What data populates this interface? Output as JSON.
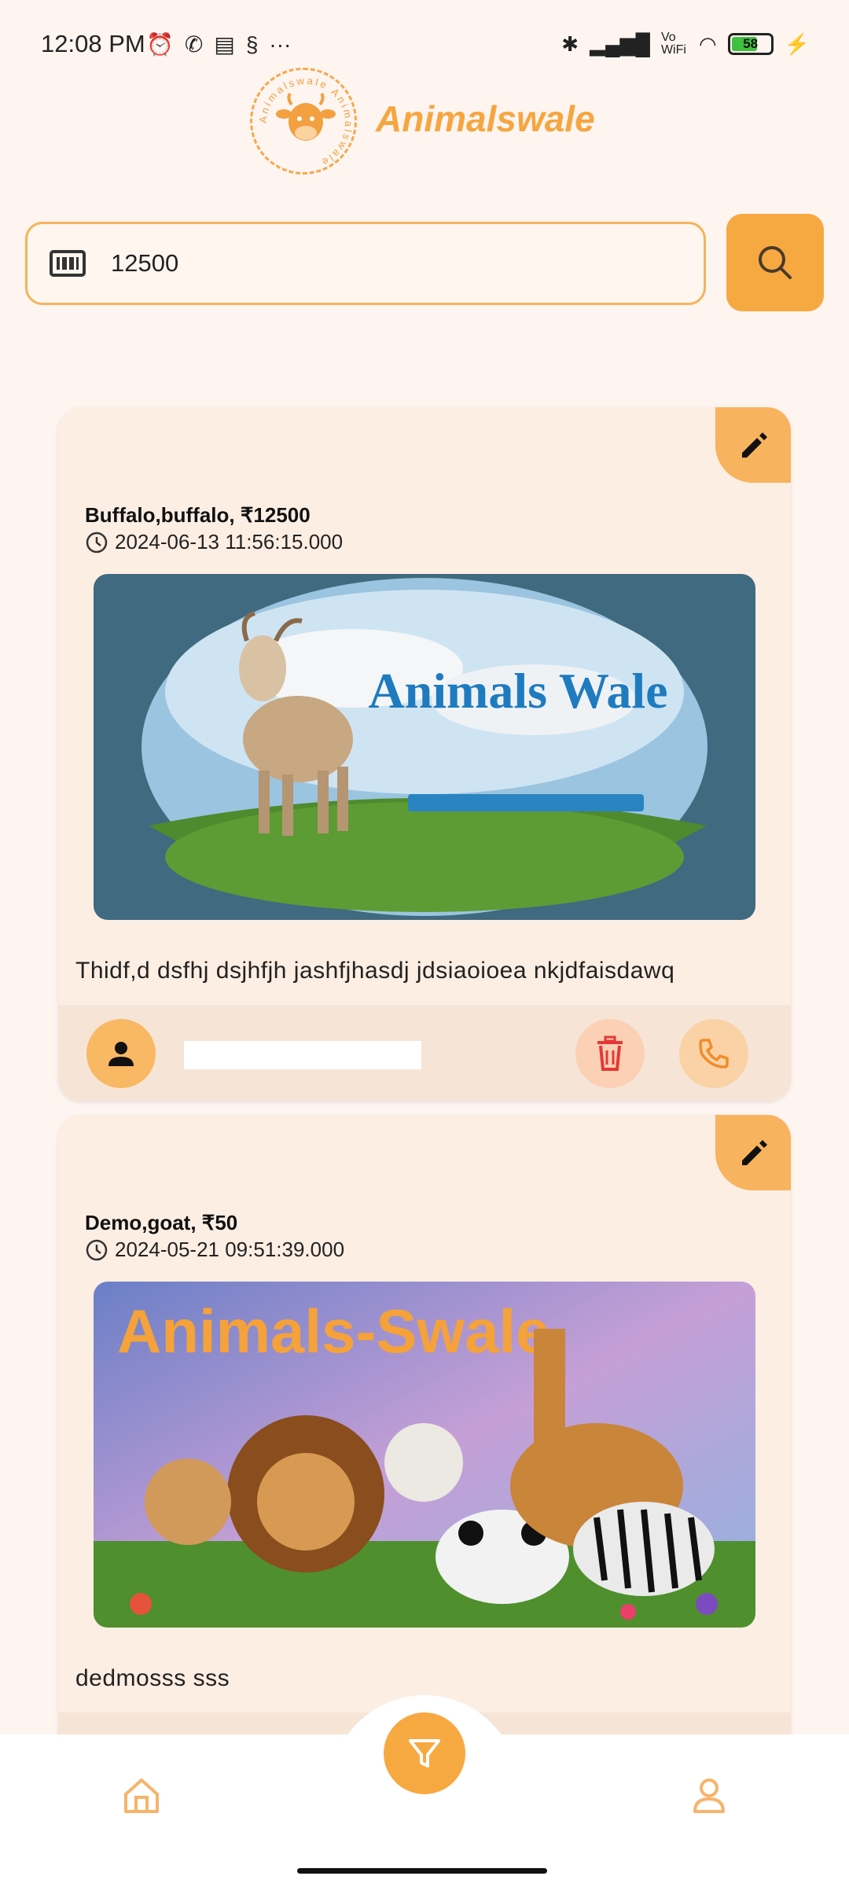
{
  "status_bar": {
    "time": "12:08 PM",
    "network_label": "Vo WiFi",
    "battery_level": "58"
  },
  "header": {
    "app_name": "Animalswale",
    "logo_ring_text": "Animalswale Animalswale"
  },
  "search": {
    "value": "12500",
    "icon": "barcode-icon",
    "button_icon": "search-icon"
  },
  "listings": [
    {
      "title": "Buffalo,buffalo, ₹12500",
      "datetime": "2024-06-13 11:56:15.000",
      "image_text": "Animals Wale",
      "description": "Thidf,d dsfhj dsjhfjh jashfjhasdj jdsiaoioea nkjdfaisdawq"
    },
    {
      "title": "Demo,goat, ₹50",
      "datetime": "2024-05-21 09:51:39.000",
      "image_text": "Animals-Swale.",
      "description": "dedmosss sss"
    }
  ],
  "colors": {
    "accent": "#f7a941",
    "background": "#fef5f1",
    "card": "#fdeee3",
    "delete": "#e53935"
  },
  "nav": {
    "left_icon": "home-icon",
    "center_icon": "filter-icon",
    "right_icon": "profile-icon"
  }
}
